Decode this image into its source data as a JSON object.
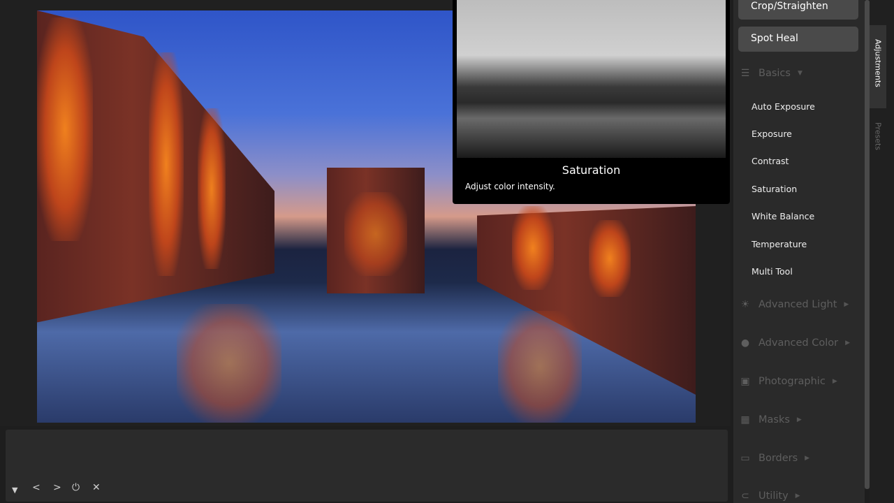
{
  "tooltip": {
    "title": "Saturation",
    "description": "Adjust color intensity."
  },
  "panel": {
    "buttons": [
      {
        "label": "Crop/Straighten"
      },
      {
        "label": "Spot Heal"
      }
    ],
    "basics": {
      "label": "Basics",
      "icon": "sliders-icon",
      "items": [
        "Auto Exposure",
        "Exposure",
        "Contrast",
        "Saturation",
        "White Balance",
        "Temperature",
        "Multi Tool"
      ]
    },
    "sections": [
      {
        "label": "Advanced Light",
        "icon": "sun-icon"
      },
      {
        "label": "Advanced Color",
        "icon": "color-circles-icon"
      },
      {
        "label": "Photographic",
        "icon": "camera-icon"
      },
      {
        "label": "Masks",
        "icon": "checker-icon"
      },
      {
        "label": "Borders",
        "icon": "rectangle-icon"
      },
      {
        "label": "Utility",
        "icon": "plug-icon"
      }
    ]
  },
  "tabs": [
    {
      "label": "Adjustments",
      "active": true
    },
    {
      "label": "Presets",
      "active": false
    }
  ],
  "controls": [
    "collapse",
    "previous",
    "next",
    "power",
    "close"
  ]
}
